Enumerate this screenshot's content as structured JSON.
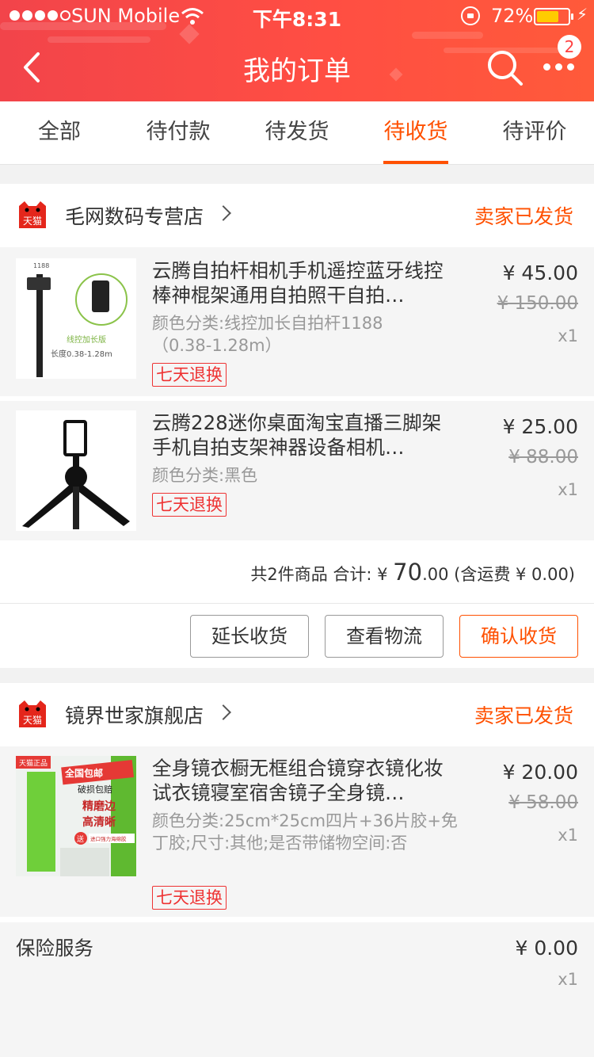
{
  "status_bar": {
    "carrier": "SUN Mobile",
    "time": "下午8:31",
    "battery": "72%",
    "battery_level": 0.72
  },
  "header": {
    "title": "我的订单",
    "badge": "2"
  },
  "tabs": [
    {
      "label": "全部"
    },
    {
      "label": "待付款"
    },
    {
      "label": "待发货"
    },
    {
      "label": "待收货",
      "active": true
    },
    {
      "label": "待评价"
    }
  ],
  "orders": [
    {
      "shop_logo": "天猫",
      "shop_name": "毛网数码专营店",
      "status": "卖家已发货",
      "items": [
        {
          "title": "云腾自拍杆相机手机遥控蓝牙线控棒神棍架通用自拍照干自拍…",
          "spec": "颜色分类:线控加长自拍杆1188（0.38-1.28m）",
          "tag": "七天退换",
          "price": "¥ 45.00",
          "old_price": "¥ 150.00",
          "qty": "x1",
          "image_text": {
            "code": "1188",
            "label": "线控加长版",
            "length": "长度0.38-1.28m"
          }
        },
        {
          "title": "云腾228迷你桌面淘宝直播三脚架手机自拍支架神器设备相机…",
          "spec": "颜色分类:黑色",
          "tag": "七天退换",
          "price": "¥ 25.00",
          "old_price": "¥ 88.00",
          "qty": "x1"
        }
      ],
      "summary": {
        "prefix": "共2件商品 合计: ¥ ",
        "amount_int": "70",
        "amount_dec": ".00",
        "suffix": " (含运费 ¥ 0.00)"
      },
      "actions": {
        "extend": "延长收货",
        "logistics": "查看物流",
        "confirm": "确认收货"
      }
    },
    {
      "shop_logo": "天猫",
      "shop_name": "镜界世家旗舰店",
      "status": "卖家已发货",
      "items": [
        {
          "title": "全身镜衣橱无框组合镜穿衣镜化妆试衣镜寝室宿舍镜子全身镜…",
          "spec": "颜色分类:25cm*25cm四片+36片胶+免丁胶;尺寸:其他;是否带储物空间:否",
          "tag": "七天退换",
          "price": "¥ 20.00",
          "old_price": "¥ 58.00",
          "qty": "x1",
          "image_text": {
            "corner": "天猫正品",
            "free_ship": "全国包邮",
            "guarantee": "破损包赔",
            "edge1": "精磨边",
            "edge2": "高清晰",
            "gift": "送",
            "glue": "进口强力海绵胶"
          }
        }
      ],
      "insurance": {
        "label": "保险服务",
        "price": "¥ 0.00",
        "qty": "x1"
      }
    }
  ],
  "colors": {
    "header_red": "#ff4e43",
    "accent_orange": "#ff5000",
    "tag_red": "#e33333"
  }
}
